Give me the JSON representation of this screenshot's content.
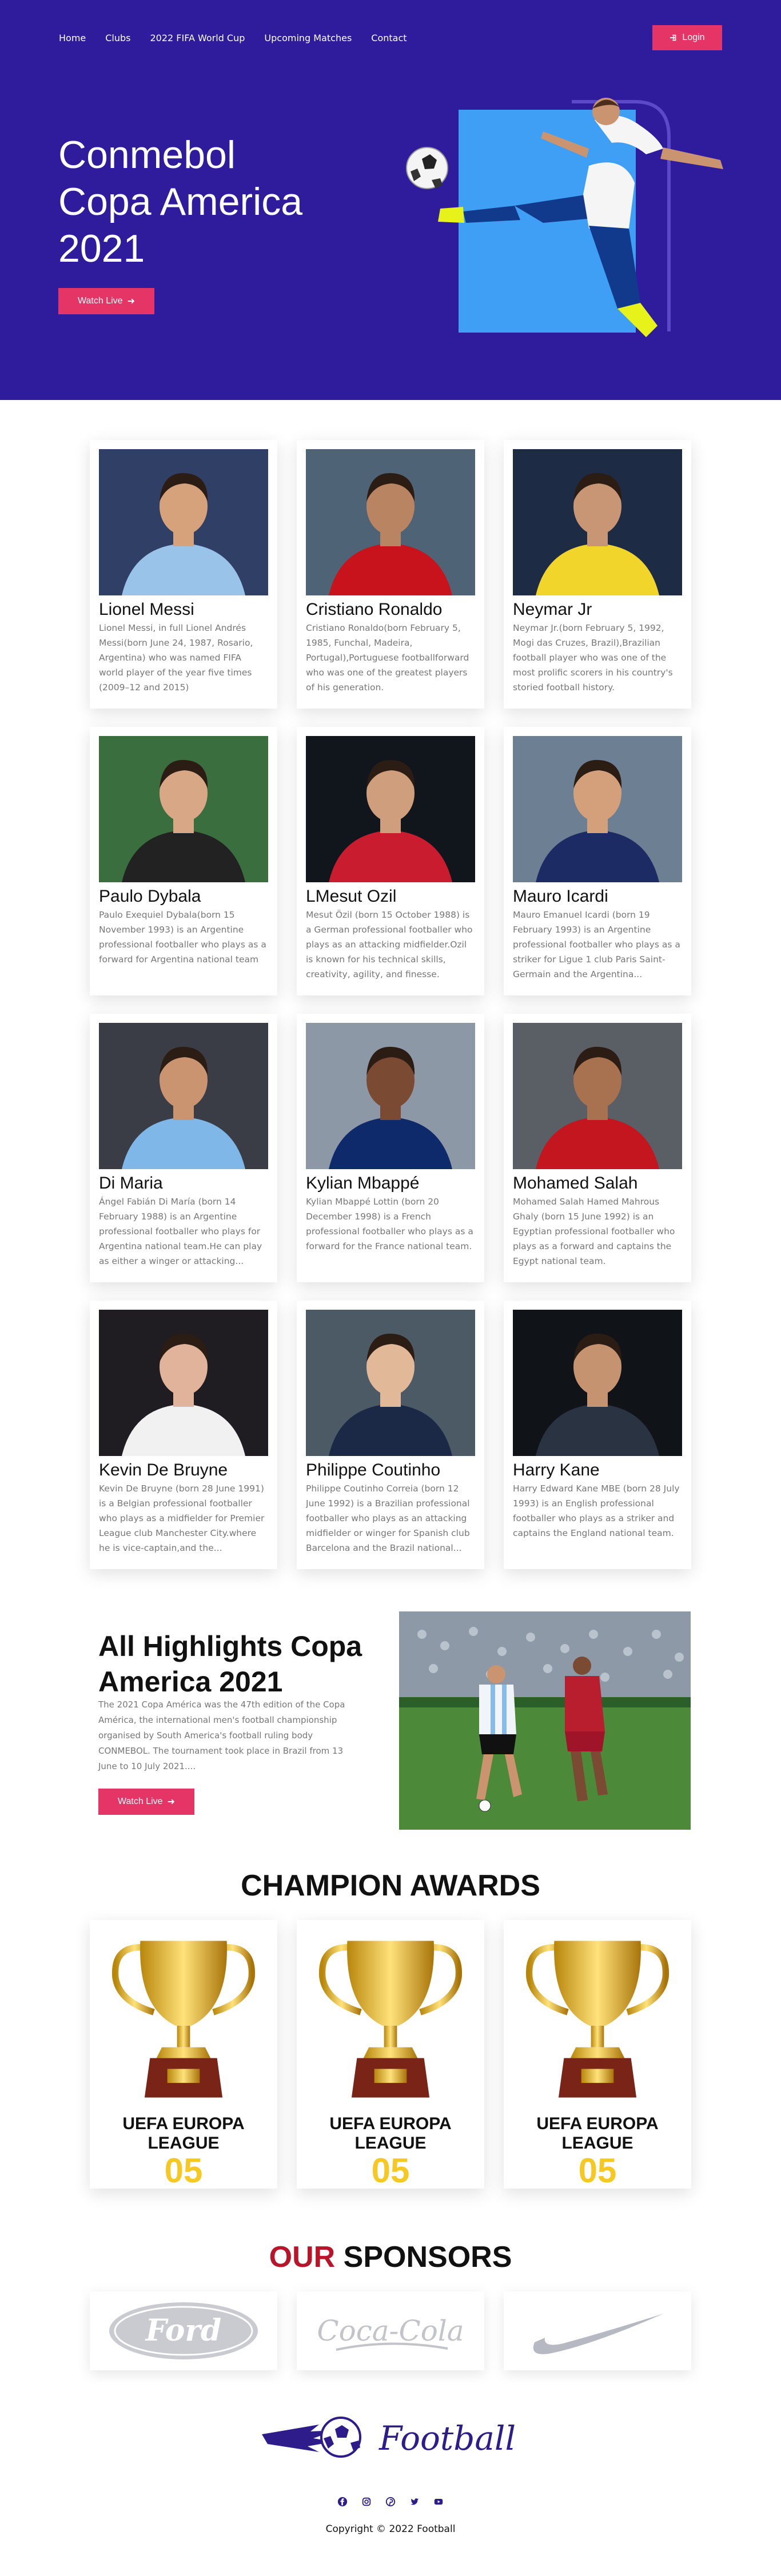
{
  "nav": {
    "items": [
      "Home",
      "Clubs",
      "2022 FIFA World Cup",
      "Upcoming Matches",
      "Contact"
    ],
    "login_label": "Login"
  },
  "hero": {
    "title_lines": [
      "Conmebol",
      "Copa America",
      "2021"
    ],
    "cta_label": "Watch Live"
  },
  "players": [
    {
      "name": "Lionel Messi",
      "bio": "Lionel Messi, in full Lionel Andrés Messi(born June 24, 1987, Rosario, Argentina) who was named FIFA world player of the year five times (2009–12 and 2015)",
      "kit": "#9ac3ea",
      "skin": "#d5a27c",
      "bg": "#2f3f66"
    },
    {
      "name": "Cristiano Ronaldo",
      "bio": "Cristiano Ronaldo(born February 5, 1985, Funchal, Madeira, Portugal),Portuguese footballforward who was one of the greatest players of his generation.",
      "kit": "#c8121c",
      "skin": "#b98461",
      "bg": "#4e6375"
    },
    {
      "name": "Neymar Jr",
      "bio": "Neymar Jr.(born February 5, 1992, Mogi das Cruzes, Brazil),Brazilian football player who was one of the most prolific scorers in his country's storied football history.",
      "kit": "#f2d52b",
      "skin": "#c89674",
      "bg": "#1d2b44"
    },
    {
      "name": "Paulo Dybala",
      "bio": "Paulo Exequiel Dybala(born 15 November 1993) is an Argentine professional footballer who plays as a forward for Argentina national team",
      "kit": "#222222",
      "skin": "#d7a786",
      "bg": "#3a6e3f"
    },
    {
      "name": "LMesut Ozil",
      "bio": "Mesut Özil (born 15 October 1988) is a German professional footballer who plays as an attacking midfielder.Ozil is known for his technical skills, creativity, agility, and finesse.",
      "kit": "#c91d2f",
      "skin": "#cf9f7d",
      "bg": "#11151c"
    },
    {
      "name": "Mauro Icardi",
      "bio": "Mauro Emanuel Icardi (born 19 February 1993) is an Argentine professional footballer who plays as a striker for Ligue 1 club Paris Saint-Germain and the Argentina...",
      "kit": "#1c2b64",
      "skin": "#d3a07b",
      "bg": "#6d7f93"
    },
    {
      "name": "Di Maria",
      "bio": "Ángel Fabián Di María (born 14 February 1988) is an Argentine professional footballer who plays for Argentina national team.He can play as either a winger or attacking...",
      "kit": "#7fb8e8",
      "skin": "#c9946f",
      "bg": "#3a3d46"
    },
    {
      "name": "Kylian Mbappé",
      "bio": "Kylian Mbappé Lottin (born 20 December 1998) is a French professional footballer who plays as a forward for the France national team.",
      "kit": "#0f2a6b",
      "skin": "#7a4a32",
      "bg": "#8c98a6"
    },
    {
      "name": "Mohamed Salah",
      "bio": "Mohamed Salah Hamed Mahrous Ghaly (born 15 June 1992) is an Egyptian professional footballer who plays as a forward and captains the Egypt national team.",
      "kit": "#c3161f",
      "skin": "#a8714f",
      "bg": "#5a5f66"
    },
    {
      "name": "Kevin De Bruyne",
      "bio": "Kevin De Bruyne (born 28 June 1991) is a Belgian professional footballer who plays as a midfielder for Premier League club Manchester City.where he is vice-captain,and the...",
      "kit": "#f1f1f1",
      "skin": "#e0b39a",
      "bg": "#1f1c22"
    },
    {
      "name": "Philippe Coutinho",
      "bio": "Philippe Coutinho Correia (born 12 June 1992) is a Brazilian professional footballer who plays as an attacking midfielder or winger for Spanish club Barcelona and the Brazil national...",
      "kit": "#1b2846",
      "skin": "#e2b998",
      "bg": "#4c5a66"
    },
    {
      "name": "Harry Kane",
      "bio": "Harry Edward Kane MBE (born 28 July 1993) is an English professional footballer who plays as a striker and captains the England national team.",
      "kit": "#2a3342",
      "skin": "#c69371",
      "bg": "#101418"
    }
  ],
  "highlights": {
    "title": "All Highlights Copa America 2021",
    "text": "The 2021 Copa América was the 47th edition of the Copa América, the international men's football championship organised by South America's football ruling body CONMEBOL. The tournament took place in Brazil from 13 June to 10 July 2021....",
    "cta_label": "Watch Live"
  },
  "awards": {
    "title": "CHAMPION AWARDS",
    "items": [
      {
        "name": "UEFA EUROPA LEAGUE",
        "count": "05"
      },
      {
        "name": "UEFA EUROPA LEAGUE",
        "count": "05"
      },
      {
        "name": "UEFA EUROPA LEAGUE",
        "count": "05"
      }
    ]
  },
  "sponsors": {
    "title_accent": "OUR",
    "title_rest": "SPONSORS",
    "logos": [
      "Ford",
      "Coca-Cola",
      "nike-swoosh-icon"
    ]
  },
  "footer": {
    "brand": "Football",
    "socials": [
      "facebook-icon",
      "instagram-icon",
      "pinterest-icon",
      "twitter-icon",
      "youtube-icon"
    ],
    "copyright": "Copyright © 2022 Football"
  },
  "colors": {
    "hero_bg": "#2e1c9d",
    "button": "#e53466",
    "award_count": "#f5c824",
    "sponsor_accent": "#b8152b",
    "brand_blue": "#2d1c8a"
  }
}
